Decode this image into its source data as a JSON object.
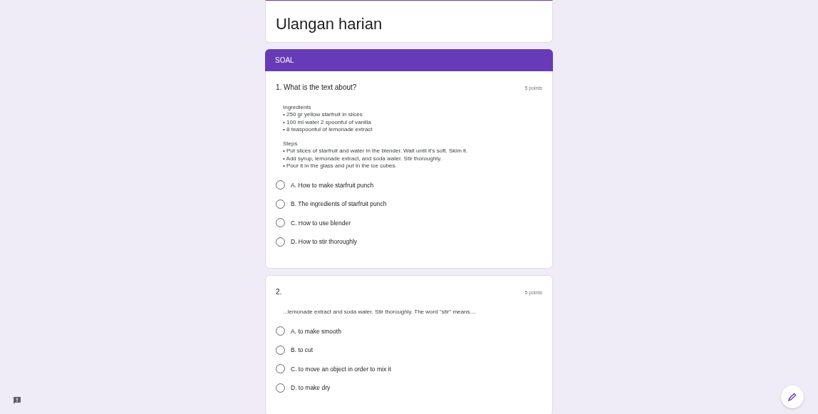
{
  "form": {
    "title": "Ulangan harian"
  },
  "section": {
    "title": "SOAL"
  },
  "questions": [
    {
      "title": "1. What is the text about?",
      "points": "5 points",
      "passage": [
        {
          "heading": "Ingredients",
          "lines": [
            "• 250 gr yellow starfruit in slices",
            "• 100 ml water 2 spoonful of vanilla",
            "• 8 teaspoonful of lemonade extract"
          ]
        },
        {
          "heading": "Steps",
          "lines": [
            "• Put slices of starfruit and water in the blender. Wait until it's soft. Skim it.",
            "• Add syrup, lemonade extract, and soda water. Stir thoroughly.",
            "• Pour it in the glass and put in the ice cubes."
          ]
        }
      ],
      "options": [
        {
          "label": "A. How to make starfruit punch",
          "selected": false
        },
        {
          "label": "B. The ingredients of starfruit punch",
          "selected": false
        },
        {
          "label": "C. How to use blender",
          "selected": false
        },
        {
          "label": "D. How to stir thoroughly",
          "selected": false
        }
      ]
    },
    {
      "title": "2.",
      "points": "5 points",
      "passage": [
        {
          "lines": [
            "...lemonade extract and soda water. Stir thoroughly. The word \"stir\" means...."
          ]
        }
      ],
      "options": [
        {
          "label": "A. to make smooth",
          "selected": false
        },
        {
          "label": "B. to cut",
          "selected": false
        },
        {
          "label": "C. to move an object in order to mix it",
          "selected": false
        },
        {
          "label": "D. to make dry",
          "selected": false
        }
      ]
    }
  ]
}
